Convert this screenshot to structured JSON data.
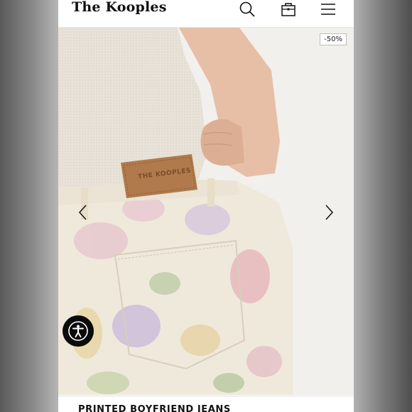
{
  "header": {
    "brand": "The Kooples",
    "icons": [
      "search-icon",
      "bag-icon",
      "menu-icon"
    ]
  },
  "product": {
    "discount_badge": "-50%",
    "name": "PRINTED BOYFRIEND JEANS",
    "label_patch": "THE KOOPLES"
  },
  "colors": {
    "accent": "#111111",
    "background": "#ffffff",
    "a11y_button": "#0b0b0b"
  }
}
